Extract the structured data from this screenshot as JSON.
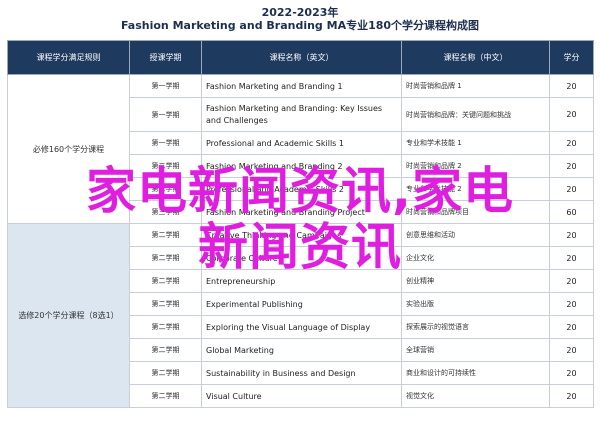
{
  "title": {
    "year": "2022-2023年",
    "main": "Fashion Marketing and Branding MA专业180个学分课程构成图"
  },
  "headers": [
    "课程学分满足规则",
    "授课学期",
    "课程名称（英文）",
    "课程名称（中文）",
    "学分"
  ],
  "groups": [
    {
      "label": "必修160个学分课程"
    },
    {
      "label": "选修20个学分课程（8选1）"
    }
  ],
  "rows": [
    {
      "sem": "第一学期",
      "en": "Fashion Marketing and Branding 1",
      "zh": "时尚营销和品牌 1",
      "credits": "20"
    },
    {
      "sem": "第一学期",
      "en": "Fashion Marketing and Branding: Key Issues and Challenges",
      "zh": "时尚营销和品牌：关键问题和挑战",
      "credits": "20"
    },
    {
      "sem": "第一学期",
      "en": "Professional and Academic Skills 1",
      "zh": "专业和学术技能 1",
      "credits": "20"
    },
    {
      "sem": "第二学期",
      "en": "Fashion Marketing and Branding 2",
      "zh": "时尚营销和品牌 2",
      "credits": "20"
    },
    {
      "sem": "第二学期",
      "en": "Professional and Academic Skills 2",
      "zh": "专业和学术技能 2",
      "credits": "20"
    },
    {
      "sem": "第三学期",
      "en": "Fashion Marketing and Branding Project",
      "zh": "时尚营销和品牌项目",
      "credits": "60"
    },
    {
      "sem": "第二学期",
      "en": "Creative Thinking and Campaigns",
      "zh": "创意思维和活动",
      "credits": "20"
    },
    {
      "sem": "第二学期",
      "en": "Corporate Culture",
      "zh": "企业文化",
      "credits": "20"
    },
    {
      "sem": "第二学期",
      "en": "Entrepreneurship",
      "zh": "创业精神",
      "credits": "20"
    },
    {
      "sem": "第二学期",
      "en": "Experimental Publishing",
      "zh": "实验出版",
      "credits": "20"
    },
    {
      "sem": "第二学期",
      "en": "Exploring the Visual Language of Display",
      "zh": "探索展示的视觉语言",
      "credits": "20"
    },
    {
      "sem": "第二学期",
      "en": "Global Marketing",
      "zh": "全球营销",
      "credits": "20"
    },
    {
      "sem": "第二学期",
      "en": "Sustainability in Business and Design",
      "zh": "商业和设计的可持续性",
      "credits": "20"
    },
    {
      "sem": "第二学期",
      "en": "Visual Culture",
      "zh": "视觉文化",
      "credits": "20"
    }
  ],
  "overlay": {
    "line1": "家电新闻资讯,家电",
    "line2": "新闻资讯",
    "color": "#e01ee0"
  }
}
